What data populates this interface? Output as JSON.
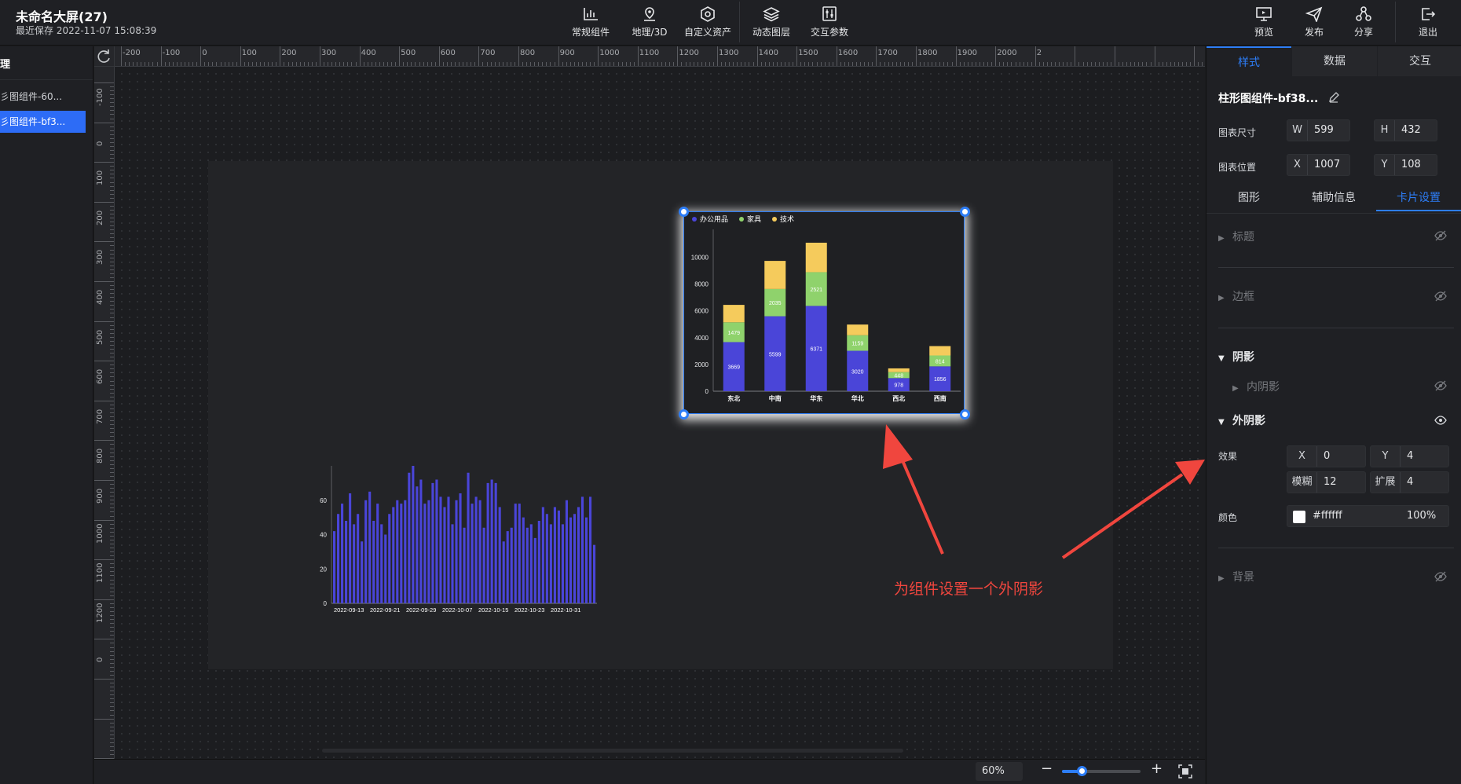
{
  "header": {
    "title": "未命名大屏(27)",
    "saved": "最近保存 2022-11-07 15:08:39",
    "tools": [
      {
        "label": "常规组件",
        "icon": "bar-chart-icon"
      },
      {
        "label": "地理/3D",
        "icon": "map-pin-icon"
      },
      {
        "label": "自定义资产",
        "icon": "hexagon-icon"
      },
      {
        "label": "动态图层",
        "icon": "layers-icon"
      },
      {
        "label": "交互参数",
        "icon": "sliders-icon"
      }
    ],
    "actions": [
      {
        "label": "预览",
        "icon": "monitor-icon"
      },
      {
        "label": "发布",
        "icon": "send-icon"
      },
      {
        "label": "分享",
        "icon": "share-icon"
      },
      {
        "label": "退出",
        "icon": "exit-icon"
      }
    ]
  },
  "left_panel": {
    "title": "理",
    "layers": [
      {
        "label": "彡图组件-60..."
      },
      {
        "label": "彡图组件-bf3..."
      }
    ]
  },
  "rulers": {
    "h_labels": [
      "-200",
      "-100",
      "0",
      "100",
      "200",
      "300",
      "400",
      "500",
      "600",
      "700",
      "800",
      "900",
      "1000",
      "1100",
      "1200",
      "1300",
      "1400",
      "1500",
      "1600",
      "1700",
      "1800",
      "1900",
      "2000",
      "2"
    ],
    "v_labels": [
      "-100",
      "0",
      "100",
      "200",
      "300",
      "400",
      "500",
      "600",
      "700",
      "800",
      "900",
      "1000",
      "1100",
      "1200",
      "0"
    ]
  },
  "bottom_bar": {
    "zoom": "60%",
    "zoom_level": 0.25,
    "minus": "−",
    "plus": "+"
  },
  "right_panel": {
    "tabs": [
      "样式",
      "数据",
      "交互"
    ],
    "active_tab": "样式",
    "component_title": "柱形图组件-bf38...",
    "size_label": "图表尺寸",
    "w_prefix": "W",
    "w_value": "599",
    "h_prefix": "H",
    "h_value": "432",
    "pos_label": "图表位置",
    "x_prefix": "X",
    "x_value": "1007",
    "y_prefix": "Y",
    "y_value": "108",
    "sub_tabs": [
      "图形",
      "辅助信息",
      "卡片设置"
    ],
    "active_sub_tab": "卡片设置",
    "sections": {
      "title": "标题",
      "border": "边框",
      "shadow": "阴影",
      "inner_shadow": "内阴影",
      "outer_shadow": "外阴影",
      "background": "背景"
    },
    "effect_label": "效果",
    "shadow_x_prefix": "X",
    "shadow_x": "0",
    "shadow_y_prefix": "Y",
    "shadow_y": "4",
    "blur_prefix": "模糊",
    "blur": "12",
    "spread_prefix": "扩展",
    "spread": "4",
    "color_label": "颜色",
    "color_value": "#ffffff",
    "opacity": "100%"
  },
  "annotation": {
    "text": "为组件设置一个外阴影",
    "color": "#f0463e"
  },
  "chart_data": [
    {
      "type": "bar",
      "stacked": true,
      "categories": [
        "东北",
        "中南",
        "华东",
        "华北",
        "西北",
        "西南"
      ],
      "series": [
        {
          "name": "办公用品",
          "color": "#4a45d8",
          "values": [
            3669,
            5599,
            6371,
            3020,
            978,
            1856
          ],
          "labels": [
            "3669",
            "5599",
            "6371",
            "3020",
            "978",
            "1856"
          ]
        },
        {
          "name": "家具",
          "color": "#8fd26c",
          "values": [
            1479,
            2035,
            2521,
            1159,
            448,
            814
          ],
          "labels": [
            "1479",
            "2035",
            "2521",
            "1159",
            "448",
            "814"
          ]
        },
        {
          "name": "技术",
          "color": "#f5cb5c",
          "values": [
            1300,
            2100,
            2200,
            800,
            280,
            700
          ],
          "labels": [
            "",
            "",
            "",
            "",
            "",
            ""
          ]
        }
      ],
      "yticks": [
        "0",
        "2000",
        "4000",
        "6000",
        "8000",
        "10000"
      ],
      "ylim": [
        0,
        11500
      ],
      "legend": "top-left"
    },
    {
      "type": "bar",
      "xtick_labels": [
        "2022-09-13",
        "2022-09-21",
        "2022-09-29",
        "2022-10-07",
        "2022-10-15",
        "2022-10-23",
        "2022-10-31"
      ],
      "yticks": [
        "0",
        "20",
        "40",
        "60"
      ],
      "ylim": [
        0,
        80
      ],
      "color": "#4a45d8",
      "values": [
        42,
        52,
        58,
        48,
        64,
        46,
        52,
        36,
        60,
        65,
        48,
        58,
        46,
        40,
        52,
        56,
        60,
        58,
        60,
        76,
        80,
        68,
        72,
        58,
        60,
        70,
        72,
        62,
        56,
        62,
        46,
        60,
        64,
        44,
        76,
        58,
        62,
        60,
        44,
        70,
        72,
        70,
        56,
        36,
        42,
        44,
        58,
        58,
        50,
        44,
        46,
        38,
        48,
        56,
        52,
        46,
        56,
        54,
        46,
        60,
        50,
        52,
        56,
        62,
        50,
        62,
        34
      ]
    }
  ]
}
